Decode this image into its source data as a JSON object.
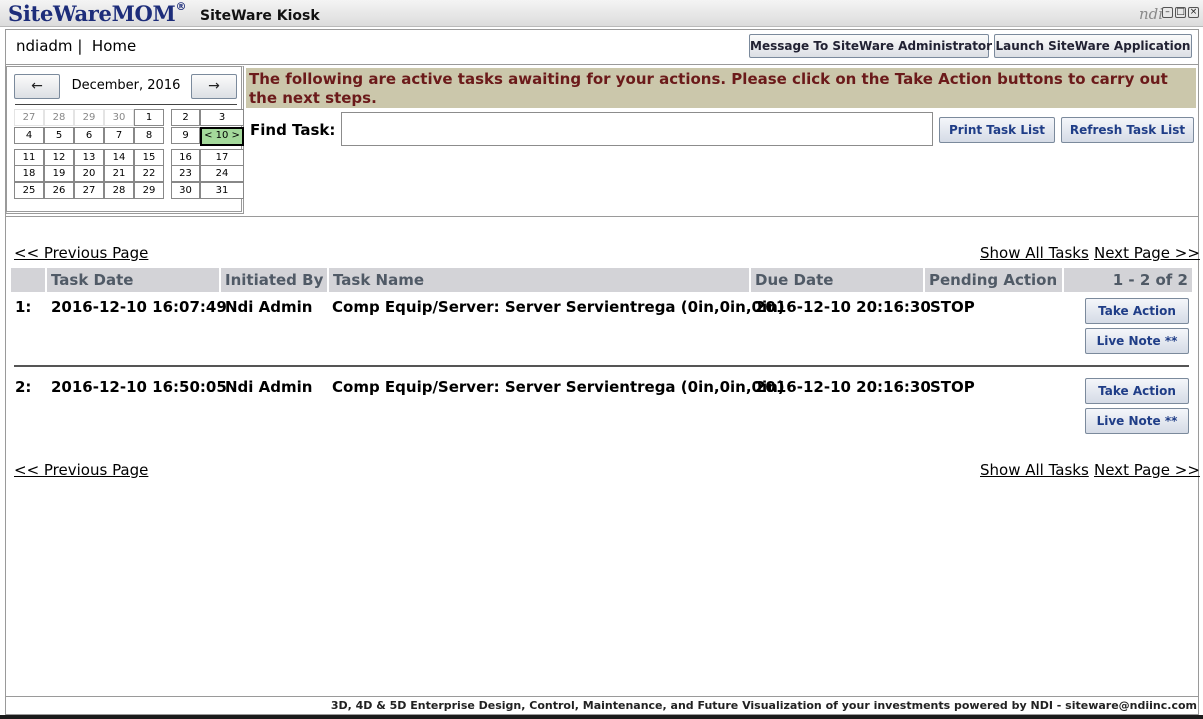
{
  "titlebar": {
    "logo": "SiteWareMOM",
    "logo_mark": "®",
    "app_title": "SiteWare Kiosk",
    "brand_mark": "ndi"
  },
  "header": {
    "user": "ndiadm",
    "separator": "|",
    "location": "Home",
    "message_button": "Message To SiteWare Administrator",
    "launch_button": "Launch SiteWare Application"
  },
  "calendar": {
    "prev_label": "←",
    "next_label": "→",
    "month": "December, 2016",
    "weeks": [
      [
        {
          "d": "27",
          "out": true
        },
        {
          "d": "28",
          "out": true
        },
        {
          "d": "29",
          "out": true
        },
        {
          "d": "30",
          "out": true
        },
        {
          "d": "1"
        },
        {
          "d": "2"
        },
        {
          "d": "3"
        }
      ],
      [
        {
          "d": "4"
        },
        {
          "d": "5"
        },
        {
          "d": "6"
        },
        {
          "d": "7"
        },
        {
          "d": "8"
        },
        {
          "d": "9"
        },
        {
          "d": "< 10 >",
          "today": true
        }
      ],
      [
        {
          "d": "11"
        },
        {
          "d": "12"
        },
        {
          "d": "13"
        },
        {
          "d": "14"
        },
        {
          "d": "15"
        },
        {
          "d": "16"
        },
        {
          "d": "17"
        }
      ],
      [
        {
          "d": "18"
        },
        {
          "d": "19"
        },
        {
          "d": "20"
        },
        {
          "d": "21"
        },
        {
          "d": "22"
        },
        {
          "d": "23"
        },
        {
          "d": "24"
        }
      ],
      [
        {
          "d": "25"
        },
        {
          "d": "26"
        },
        {
          "d": "27"
        },
        {
          "d": "28"
        },
        {
          "d": "29"
        },
        {
          "d": "30"
        },
        {
          "d": "31"
        }
      ]
    ],
    "today_color": "#a4d99b"
  },
  "banner": {
    "text": "The following are active tasks awaiting for your actions. Please click on the Take Action buttons to carry out the next steps.",
    "background": "#cbc7ab",
    "color": "#6b1a1a"
  },
  "find": {
    "label": "Find Task:",
    "value": "",
    "print_button": "Print Task List",
    "refresh_button": "Refresh Task List"
  },
  "pager": {
    "previous": "<< Previous Page",
    "show_all": "Show All Tasks",
    "next": "Next Page >>"
  },
  "table": {
    "headers": [
      "Task Date",
      "Initiated By",
      "Task Name",
      "Due Date",
      "Pending Action"
    ],
    "range": "1 - 2 of 2",
    "rows": [
      {
        "num": "1:",
        "task_date": "2016-12-10 16:07:49",
        "initiated_by": "Ndi Admin",
        "task_name": "Comp Equip/Server: Server Servientrega (0in,0in,0in)",
        "due_date": "2016-12-10 20:16:30",
        "pending_action": "STOP",
        "take_action": "Take Action",
        "live_note": "Live Note **"
      },
      {
        "num": "2:",
        "task_date": "2016-12-10 16:50:05",
        "initiated_by": "Ndi Admin",
        "task_name": "Comp Equip/Server: Server Servientrega (0in,0in,0in)",
        "due_date": "2016-12-10 20:16:30",
        "pending_action": "STOP",
        "take_action": "Take Action",
        "live_note": "Live Note **"
      }
    ]
  },
  "footer": {
    "text": "3D, 4D & 5D Enterprise Design, Control, Maintenance, and Future Visualization of your investments powered by NDI - siteware@ndiinc.com"
  }
}
